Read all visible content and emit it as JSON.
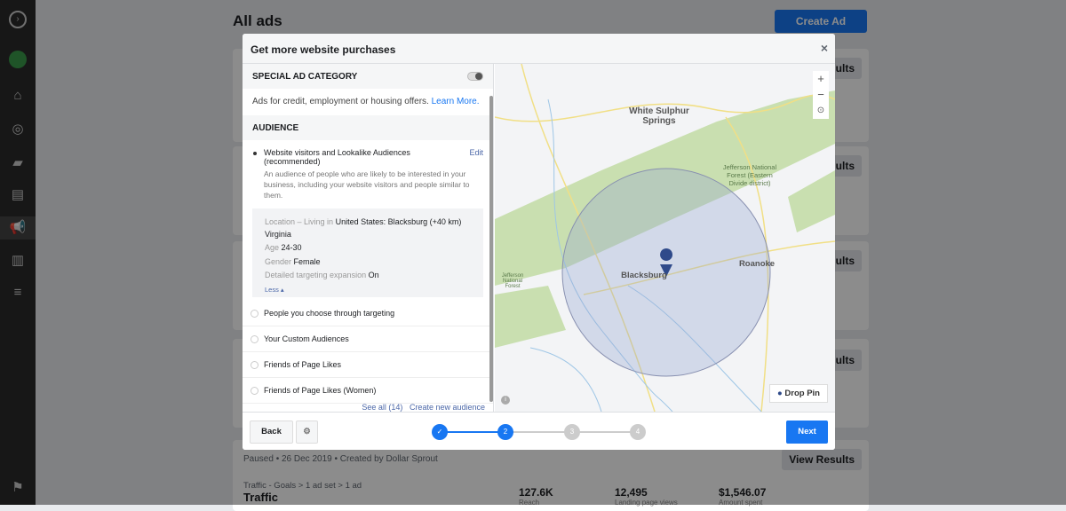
{
  "page": {
    "title": "All ads",
    "create_ad": "Create Ad",
    "view_results": "View Results",
    "view_results_cut": "ults",
    "row": {
      "status": "Paused",
      "date": "26 Dec 2019",
      "creator": "Created by Dollar Sprout",
      "breadcrumb": "Traffic - Goals > 1 ad set > 1 ad",
      "name": "Traffic",
      "metrics": [
        {
          "value": "127.6K",
          "label": "Reach"
        },
        {
          "value": "12,495",
          "label": "Landing page views"
        },
        {
          "value": "$1,546.07",
          "label": "Amount spent"
        }
      ]
    }
  },
  "modal": {
    "title": "Get more website purchases",
    "close": "×",
    "special": {
      "header": "SPECIAL AD CATEGORY",
      "text": "Ads for credit, employment or housing offers.",
      "link": "Learn More."
    },
    "audience": {
      "header": "AUDIENCE",
      "selected": {
        "label": "Website visitors and Lookalike Audiences (recommended)",
        "edit": "Edit",
        "desc": "An audience of people who are likely to be interested in your business, including your website visitors and people similar to them."
      },
      "details": {
        "location_label": "Location – Living in",
        "location": "United States: Blacksburg (+40 km)",
        "region": "Virginia",
        "age_label": "Age",
        "age": "24-30",
        "gender_label": "Gender",
        "gender": "Female",
        "expansion_label": "Detailed targeting expansion",
        "expansion": "On",
        "less": "Less ▴"
      },
      "options": [
        "People you choose through targeting",
        "Your Custom Audiences",
        "Friends of Page Likes",
        "Friends of Page Likes (Women)"
      ],
      "see_all": "See all (14)",
      "create_new": "Create new audience"
    },
    "map": {
      "labels": [
        "White Sulphur Springs",
        "Jefferson National Forest (Eastern Divide district)",
        "Blacksburg",
        "Roanoke",
        "Jefferson National Forest"
      ],
      "drop_pin": "Drop Pin",
      "zoom_in": "+",
      "zoom_out": "−",
      "radius_km": 40
    },
    "footer": {
      "back": "Back",
      "next": "Next",
      "steps": [
        "✓",
        "2",
        "3",
        "4"
      ],
      "current_step": 2
    }
  }
}
